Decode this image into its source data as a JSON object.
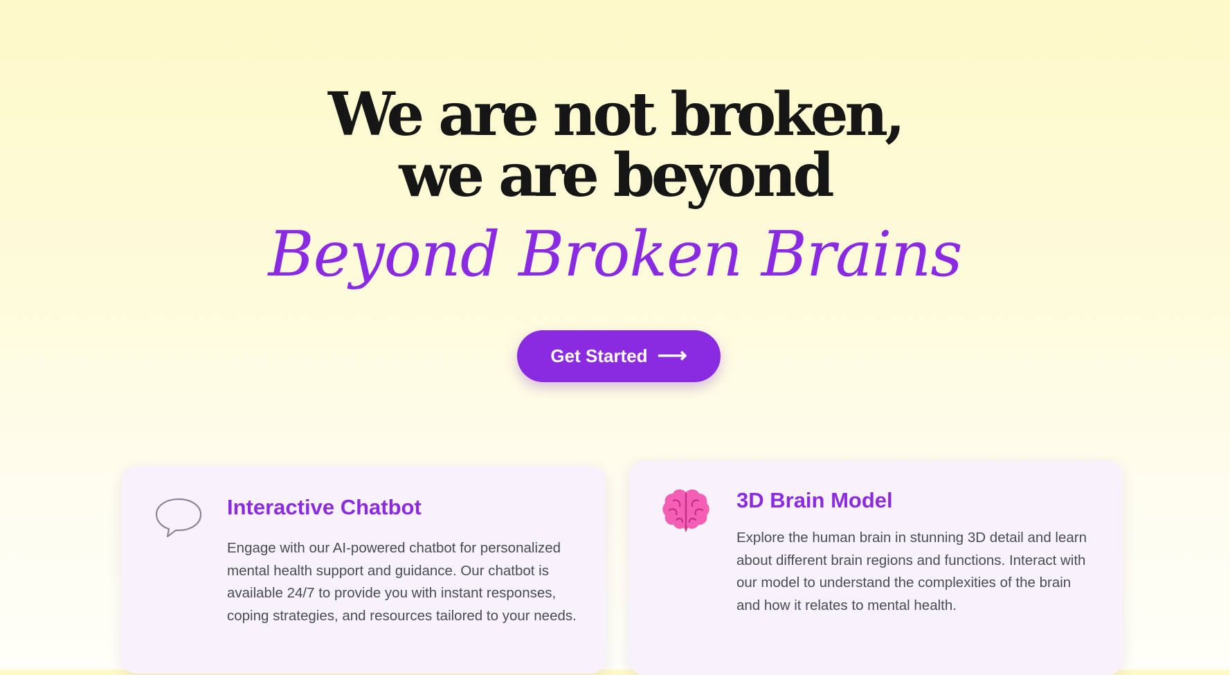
{
  "hero": {
    "headline_line1": "We are not broken,",
    "headline_line2": "we are beyond",
    "script_title": "Beyond Broken Brains",
    "cta_label": "Get Started",
    "cta_arrow": "⟶"
  },
  "features": [
    {
      "icon": "speech-bubble-icon",
      "title": "Interactive Chatbot",
      "description": "Engage with our AI-powered chatbot for personalized mental health support and guidance. Our chatbot is available 24/7 to provide you with instant responses, coping strategies, and resources tailored to your needs."
    },
    {
      "icon": "brain-icon",
      "title": "3D Brain Model",
      "description": "Explore the human brain in stunning 3D detail and learn about different brain regions and functions. Interact with our model to understand the complexities of the brain and how it relates to mental health."
    }
  ],
  "colors": {
    "accent": "#8a2be2",
    "headline": "#161616",
    "body_text": "#4a4a58",
    "card_bg": "#f7f2fb",
    "brain_pink": "#f25fb4"
  }
}
